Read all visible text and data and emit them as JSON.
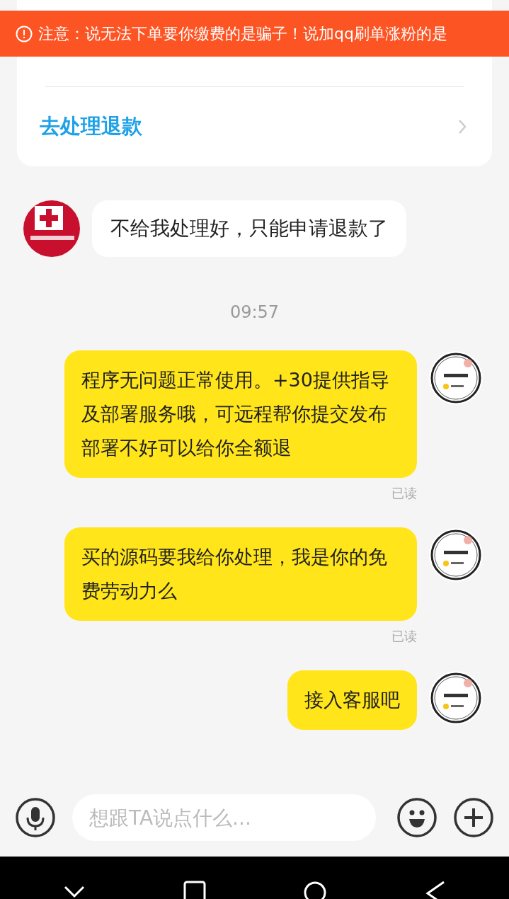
{
  "banner": {
    "text": "注意：说无法下单要你缴费的是骗子！说加qq刷单涨粉的是"
  },
  "refund_card": {
    "link": "去处理退款"
  },
  "messages": [
    {
      "kind": "incoming",
      "text": "不给我处理好，只能申请退款了"
    },
    {
      "kind": "time",
      "text": "09:57"
    },
    {
      "kind": "outgoing",
      "text": "程序无问题正常使用。+30提供指导及部署服务哦，可远程帮你提交发布部署不好可以给你全额退",
      "status": "已读"
    },
    {
      "kind": "outgoing",
      "text": "买的源码要我给你处理，我是你的免费劳动力么",
      "status": "已读"
    },
    {
      "kind": "outgoing",
      "text": "接入客服吧"
    }
  ],
  "input": {
    "placeholder": "想跟TA说点什么..."
  }
}
